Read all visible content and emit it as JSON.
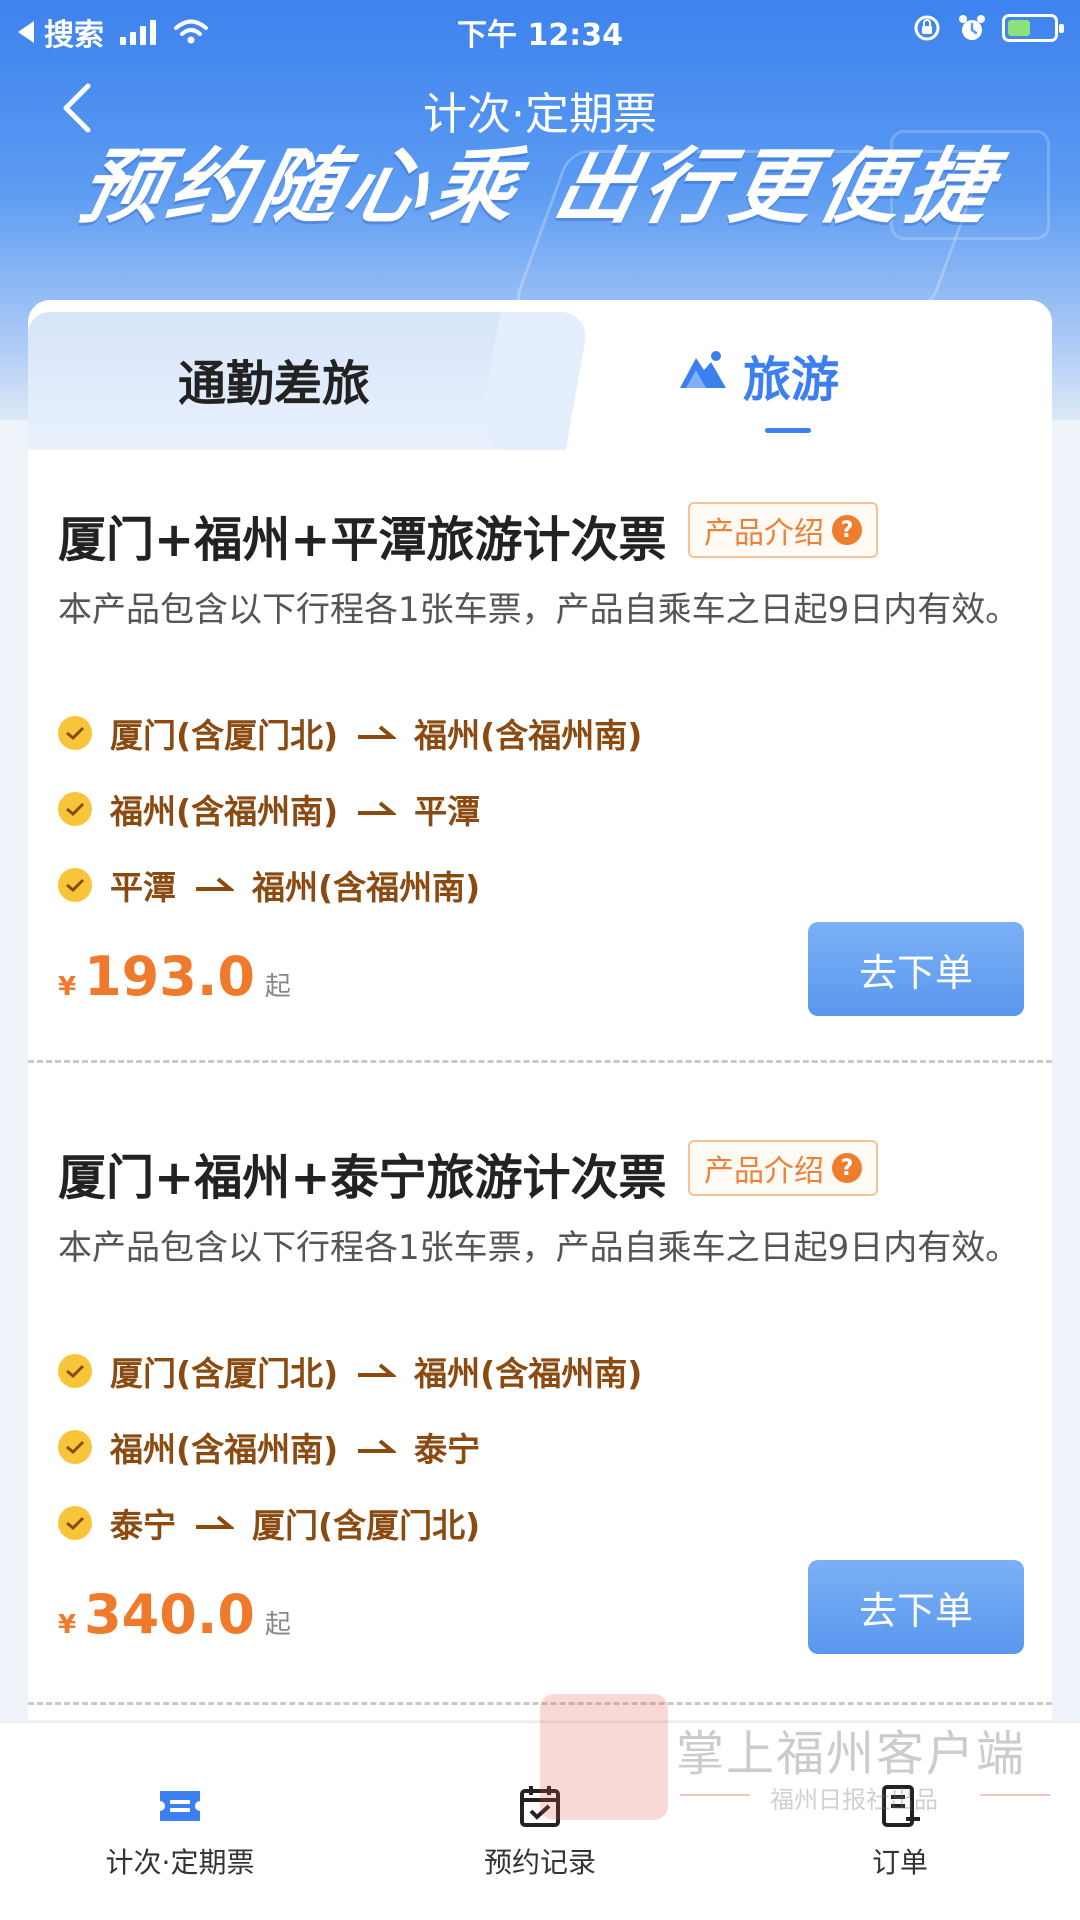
{
  "status_bar": {
    "back_app": "搜索",
    "time": "下午 12:34"
  },
  "header": {
    "title": "计次·定期票",
    "slogan": "预约随心乘 出行更便捷"
  },
  "tabs": [
    {
      "label": "通勤差旅",
      "active": false
    },
    {
      "label": "旅游",
      "active": true
    }
  ],
  "products": [
    {
      "title": "厦门+福州+平潭旅游计次票",
      "intro_label": "产品介绍",
      "description": "本产品包含以下行程各1张车票，产品自乘车之日起9日内有效。",
      "routes": [
        {
          "from": "厦门(含厦门北)",
          "to": "福州(含福州南)"
        },
        {
          "from": "福州(含福州南)",
          "to": "平潭"
        },
        {
          "from": "平潭",
          "to": "福州(含福州南)"
        }
      ],
      "currency": "¥",
      "price": "193.0",
      "price_suffix": "起",
      "order_label": "去下单"
    },
    {
      "title": "厦门+福州+泰宁旅游计次票",
      "intro_label": "产品介绍",
      "description": "本产品包含以下行程各1张车票，产品自乘车之日起9日内有效。",
      "routes": [
        {
          "from": "厦门(含厦门北)",
          "to": "福州(含福州南)"
        },
        {
          "from": "福州(含福州南)",
          "to": "泰宁"
        },
        {
          "from": "泰宁",
          "to": "厦门(含厦门北)"
        }
      ],
      "currency": "¥",
      "price": "340.0",
      "price_suffix": "起",
      "order_label": "去下单"
    }
  ],
  "bottom_nav": [
    {
      "label": "计次·定期票",
      "icon": "ticket-icon",
      "active": true
    },
    {
      "label": "预约记录",
      "icon": "calendar-check-icon",
      "active": false
    },
    {
      "label": "订单",
      "icon": "order-list-icon",
      "active": false
    }
  ],
  "watermark": {
    "main": "掌上福州客户端",
    "sub": "福州日报社出品"
  },
  "colors": {
    "accent_blue": "#3c7ff0",
    "price_orange": "#ef7a2c",
    "route_brown": "#8a4a10",
    "check_yellow": "#f8c53a"
  }
}
